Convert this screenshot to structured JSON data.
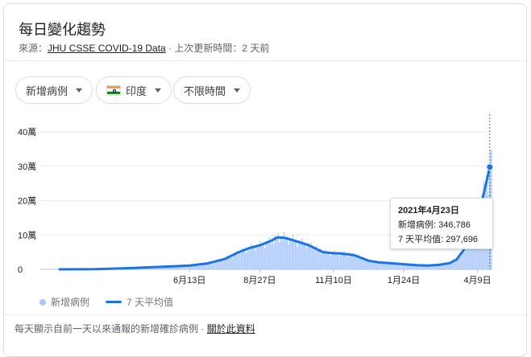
{
  "header": {
    "title": "每日變化趨勢",
    "source_prefix": "來源：",
    "source_link": "JHU CSSE COVID-19 Data",
    "source_sep": "·",
    "updated": "上次更新時間：2 天前"
  },
  "filters": {
    "metric": "新增病例",
    "country": "印度",
    "time_range": "不限時間"
  },
  "colors": {
    "bars": "#a8c7fa",
    "line": "#1a73e8",
    "grid": "#e8eaed"
  },
  "tooltip": {
    "date": "2021年4月23日",
    "cases_label": "新增病例: 346,786",
    "avg_label": "7 天平均值: 297,696"
  },
  "legend": {
    "bars": "新增病例",
    "line": "7 天平均值"
  },
  "footer": {
    "note": "每天顯示自前一天以來通報的新增確診病例",
    "sep": "·",
    "link": "關於此資料"
  },
  "chart_data": {
    "type": "bar",
    "ylim": [
      0,
      400000
    ],
    "y_ticks": [
      {
        "value": 0,
        "label": "0"
      },
      {
        "value": 100000,
        "label": "10萬"
      },
      {
        "value": 200000,
        "label": "20萬"
      },
      {
        "value": 300000,
        "label": "30萬"
      },
      {
        "value": 400000,
        "label": "40萬"
      }
    ],
    "x_ticks": [
      {
        "value": 2020.45,
        "label": "6月13日"
      },
      {
        "value": 2020.65,
        "label": "8月27日"
      },
      {
        "value": 2020.86,
        "label": "11月10日"
      },
      {
        "value": 2021.06,
        "label": "1月24日"
      },
      {
        "value": 2021.27,
        "label": "4月9日"
      }
    ],
    "xlim": [
      2020.08,
      2021.31
    ],
    "series": [
      {
        "name": "7 天平均值",
        "points": [
          [
            2020.08,
            0
          ],
          [
            2020.18,
            500
          ],
          [
            2020.26,
            3000
          ],
          [
            2020.34,
            6000
          ],
          [
            2020.4,
            9000
          ],
          [
            2020.45,
            11000
          ],
          [
            2020.5,
            17000
          ],
          [
            2020.55,
            30000
          ],
          [
            2020.59,
            50000
          ],
          [
            2020.62,
            62000
          ],
          [
            2020.65,
            70000
          ],
          [
            2020.68,
            82000
          ],
          [
            2020.7,
            93000
          ],
          [
            2020.72,
            92000
          ],
          [
            2020.74,
            86000
          ],
          [
            2020.76,
            80000
          ],
          [
            2020.79,
            70000
          ],
          [
            2020.81,
            60000
          ],
          [
            2020.83,
            50000
          ],
          [
            2020.86,
            47000
          ],
          [
            2020.88,
            46000
          ],
          [
            2020.9,
            44000
          ],
          [
            2020.92,
            41000
          ],
          [
            2020.94,
            33000
          ],
          [
            2020.96,
            25000
          ],
          [
            2020.99,
            20000
          ],
          [
            2021.02,
            18000
          ],
          [
            2021.06,
            15000
          ],
          [
            2021.1,
            12000
          ],
          [
            2021.13,
            11000
          ],
          [
            2021.16,
            13000
          ],
          [
            2021.19,
            18000
          ],
          [
            2021.21,
            28000
          ],
          [
            2021.23,
            55000
          ],
          [
            2021.25,
            100000
          ],
          [
            2021.27,
            150000
          ],
          [
            2021.29,
            230000
          ],
          [
            2021.305,
            297696
          ]
        ]
      }
    ],
    "highlight": {
      "x": 2021.305,
      "y": 297696
    }
  }
}
